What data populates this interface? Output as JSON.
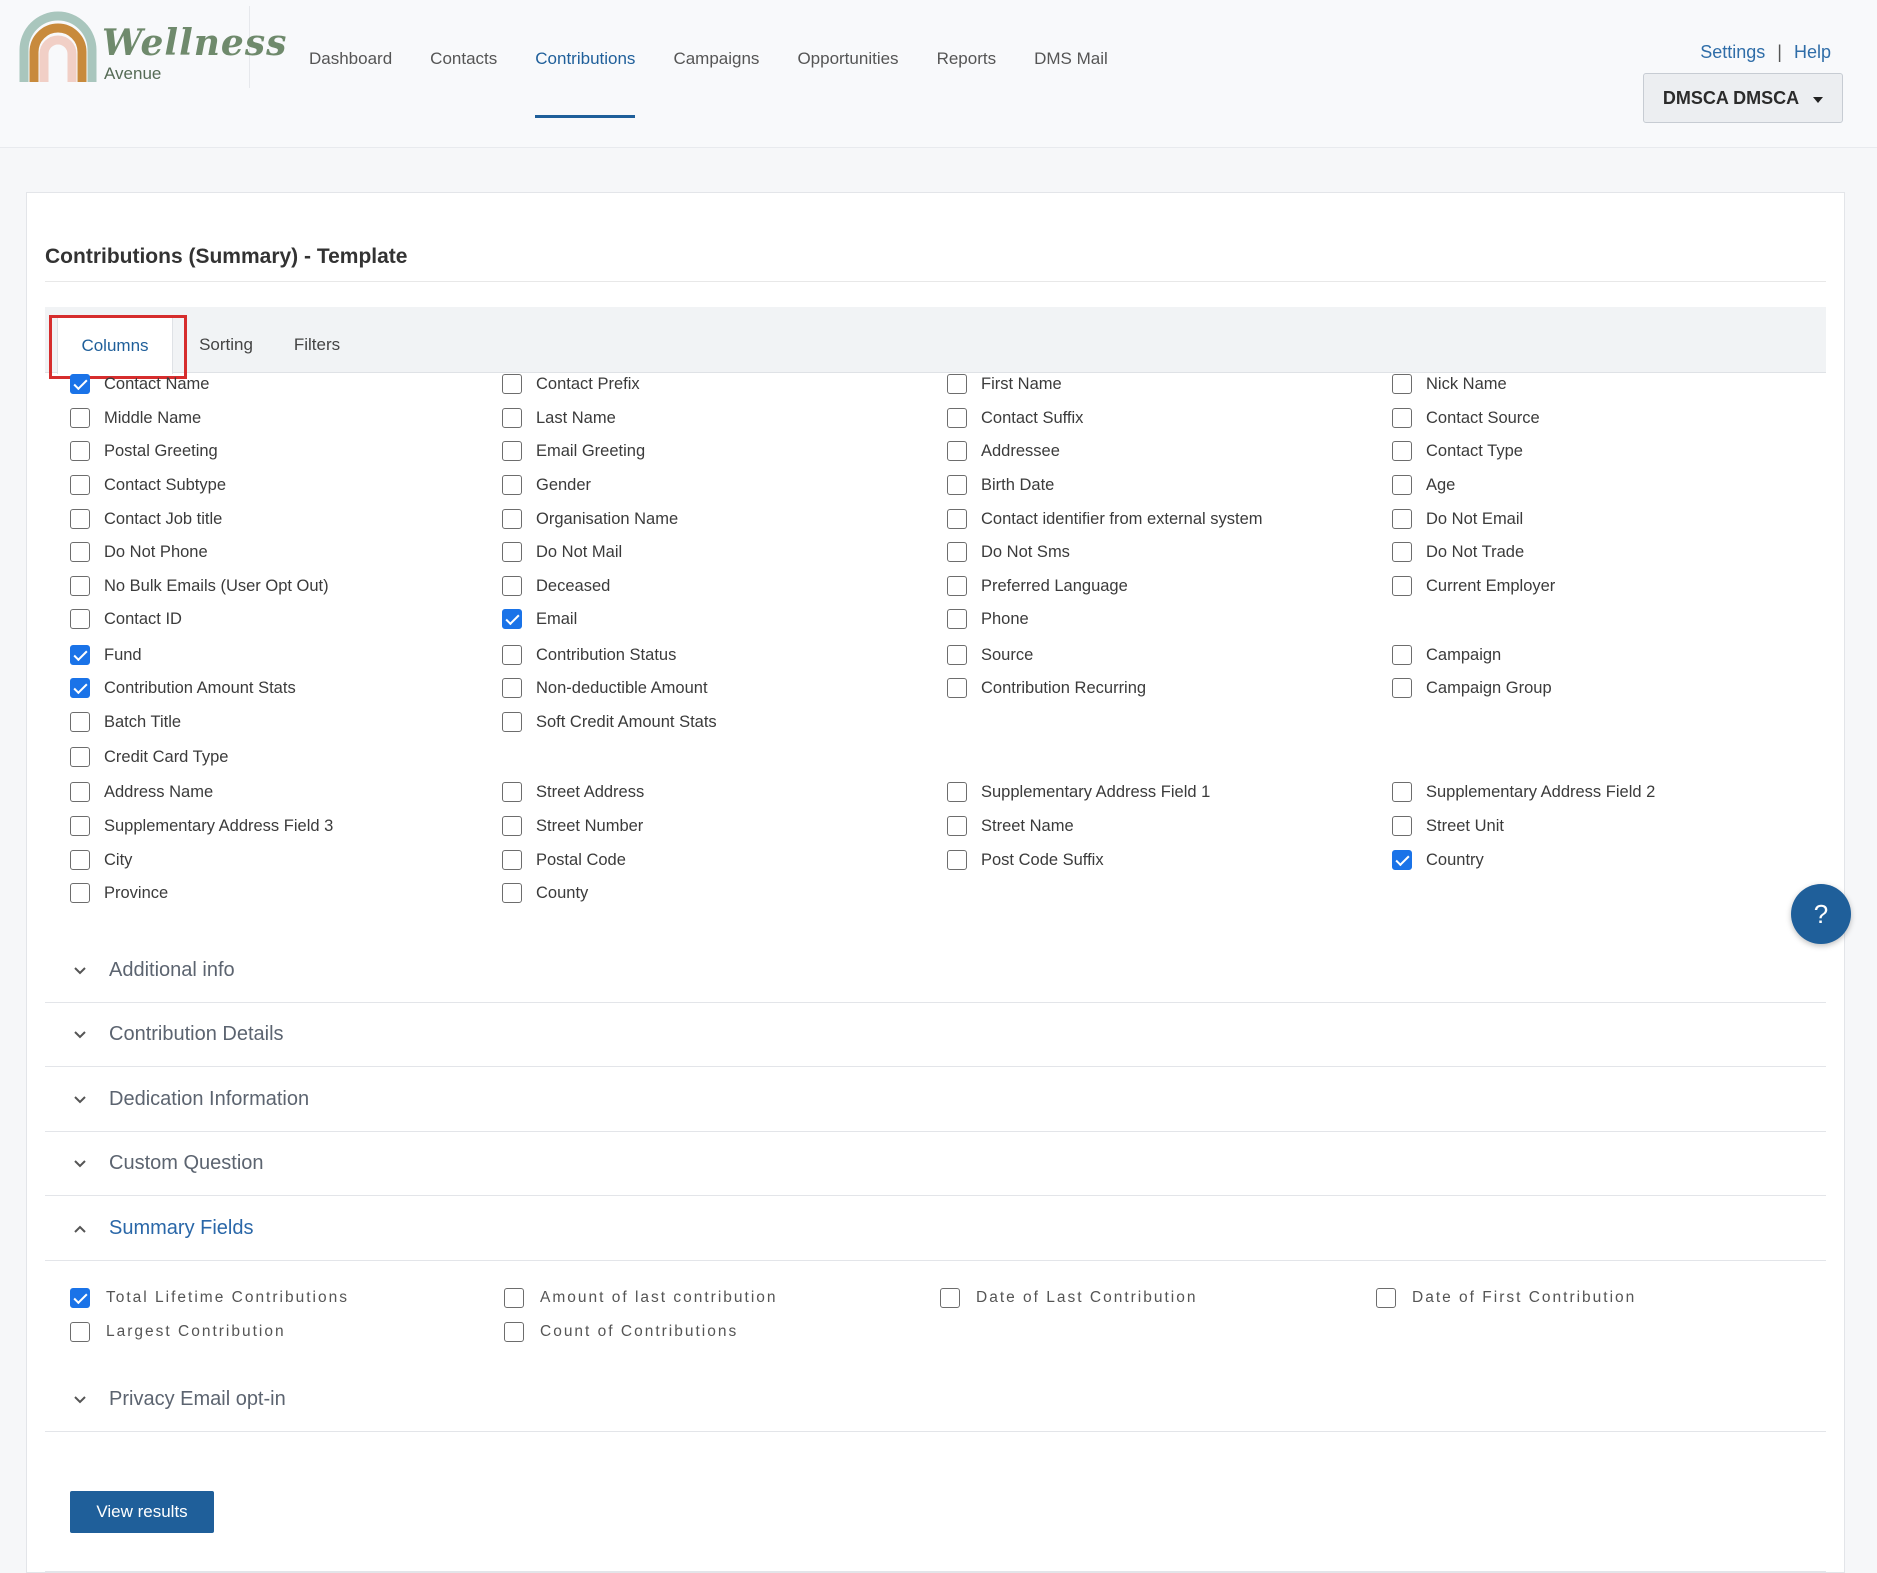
{
  "brand": {
    "name": "Wellness",
    "sub": "Avenue"
  },
  "nav": [
    {
      "label": "Dashboard"
    },
    {
      "label": "Contacts"
    },
    {
      "label": "Contributions",
      "active": true
    },
    {
      "label": "Campaigns"
    },
    {
      "label": "Opportunities"
    },
    {
      "label": "Reports"
    },
    {
      "label": "DMS Mail"
    }
  ],
  "top_links": {
    "settings": "Settings",
    "separator": "|",
    "help": "Help"
  },
  "user_menu": {
    "label": "DMSCA DMSCA"
  },
  "page_title": "Contributions (Summary) - Template",
  "tabs": [
    {
      "label": "Columns",
      "active": true
    },
    {
      "label": "Sorting"
    },
    {
      "label": "Filters"
    }
  ],
  "columns": [
    {
      "label": "Contact Name",
      "checked": true,
      "col": 0,
      "row": 0
    },
    {
      "label": "Contact Prefix",
      "checked": false,
      "col": 1,
      "row": 0
    },
    {
      "label": "First Name",
      "checked": false,
      "col": 2,
      "row": 0
    },
    {
      "label": "Nick Name",
      "checked": false,
      "col": 3,
      "row": 0
    },
    {
      "label": "Middle Name",
      "checked": false,
      "col": 0,
      "row": 1
    },
    {
      "label": "Last Name",
      "checked": false,
      "col": 1,
      "row": 1
    },
    {
      "label": "Contact Suffix",
      "checked": false,
      "col": 2,
      "row": 1
    },
    {
      "label": "Contact Source",
      "checked": false,
      "col": 3,
      "row": 1
    },
    {
      "label": "Postal Greeting",
      "checked": false,
      "col": 0,
      "row": 2
    },
    {
      "label": "Email Greeting",
      "checked": false,
      "col": 1,
      "row": 2
    },
    {
      "label": "Addressee",
      "checked": false,
      "col": 2,
      "row": 2
    },
    {
      "label": "Contact Type",
      "checked": false,
      "col": 3,
      "row": 2
    },
    {
      "label": "Contact Subtype",
      "checked": false,
      "col": 0,
      "row": 3
    },
    {
      "label": "Gender",
      "checked": false,
      "col": 1,
      "row": 3
    },
    {
      "label": "Birth Date",
      "checked": false,
      "col": 2,
      "row": 3
    },
    {
      "label": "Age",
      "checked": false,
      "col": 3,
      "row": 3
    },
    {
      "label": "Contact Job title",
      "checked": false,
      "col": 0,
      "row": 4
    },
    {
      "label": "Organisation Name",
      "checked": false,
      "col": 1,
      "row": 4
    },
    {
      "label": "Contact identifier from external system",
      "checked": false,
      "col": 2,
      "row": 4
    },
    {
      "label": "Do Not Email",
      "checked": false,
      "col": 3,
      "row": 4
    },
    {
      "label": "Do Not Phone",
      "checked": false,
      "col": 0,
      "row": 5
    },
    {
      "label": "Do Not Mail",
      "checked": false,
      "col": 1,
      "row": 5
    },
    {
      "label": "Do Not Sms",
      "checked": false,
      "col": 2,
      "row": 5
    },
    {
      "label": "Do Not Trade",
      "checked": false,
      "col": 3,
      "row": 5
    },
    {
      "label": "No Bulk Emails (User Opt Out)",
      "checked": false,
      "col": 0,
      "row": 6
    },
    {
      "label": "Deceased",
      "checked": false,
      "col": 1,
      "row": 6
    },
    {
      "label": "Preferred Language",
      "checked": false,
      "col": 2,
      "row": 6
    },
    {
      "label": "Current Employer",
      "checked": false,
      "col": 3,
      "row": 6
    },
    {
      "label": "Contact ID",
      "checked": false,
      "col": 0,
      "row": 7
    },
    {
      "label": "Email",
      "checked": true,
      "col": 1,
      "row": 7
    },
    {
      "label": "Phone",
      "checked": false,
      "col": 2,
      "row": 7
    },
    {
      "label": "Fund",
      "checked": true,
      "col": 0,
      "row": 8
    },
    {
      "label": "Contribution Status",
      "checked": false,
      "col": 1,
      "row": 8
    },
    {
      "label": "Source",
      "checked": false,
      "col": 2,
      "row": 8
    },
    {
      "label": "Campaign",
      "checked": false,
      "col": 3,
      "row": 8
    },
    {
      "label": "Contribution Amount Stats",
      "checked": true,
      "col": 0,
      "row": 9
    },
    {
      "label": "Non-deductible Amount",
      "checked": false,
      "col": 1,
      "row": 9
    },
    {
      "label": "Contribution Recurring",
      "checked": false,
      "col": 2,
      "row": 9
    },
    {
      "label": "Campaign Group",
      "checked": false,
      "col": 3,
      "row": 9
    },
    {
      "label": "Batch Title",
      "checked": false,
      "col": 0,
      "row": 10
    },
    {
      "label": "Soft Credit Amount Stats",
      "checked": false,
      "col": 1,
      "row": 10
    },
    {
      "label": "Credit Card Type",
      "checked": false,
      "col": 0,
      "row": 11
    },
    {
      "label": "Address Name",
      "checked": false,
      "col": 0,
      "row": 12
    },
    {
      "label": "Street Address",
      "checked": false,
      "col": 1,
      "row": 12
    },
    {
      "label": "Supplementary Address Field 1",
      "checked": false,
      "col": 2,
      "row": 12
    },
    {
      "label": "Supplementary Address Field 2",
      "checked": false,
      "col": 3,
      "row": 12
    },
    {
      "label": "Supplementary Address Field 3",
      "checked": false,
      "col": 0,
      "row": 13
    },
    {
      "label": "Street Number",
      "checked": false,
      "col": 1,
      "row": 13
    },
    {
      "label": "Street Name",
      "checked": false,
      "col": 2,
      "row": 13
    },
    {
      "label": "Street Unit",
      "checked": false,
      "col": 3,
      "row": 13
    },
    {
      "label": "City",
      "checked": false,
      "col": 0,
      "row": 14
    },
    {
      "label": "Postal Code",
      "checked": false,
      "col": 1,
      "row": 14
    },
    {
      "label": "Post Code Suffix",
      "checked": false,
      "col": 2,
      "row": 14
    },
    {
      "label": "Country",
      "checked": true,
      "col": 3,
      "row": 14
    },
    {
      "label": "Province",
      "checked": false,
      "col": 0,
      "row": 15
    },
    {
      "label": "County",
      "checked": false,
      "col": 1,
      "row": 15
    }
  ],
  "sections": [
    {
      "label": "Additional info",
      "open": false
    },
    {
      "label": "Contribution Details",
      "open": false
    },
    {
      "label": "Dedication Information",
      "open": false
    },
    {
      "label": "Custom Question",
      "open": false
    },
    {
      "label": "Summary Fields",
      "open": true
    },
    {
      "label": "Privacy Email opt-in",
      "open": false
    }
  ],
  "summary_fields": [
    {
      "label": "Total Lifetime Contributions",
      "checked": true,
      "col": 0,
      "row": 0
    },
    {
      "label": "Amount of last contribution",
      "checked": false,
      "col": 1,
      "row": 0
    },
    {
      "label": "Date of Last Contribution",
      "checked": false,
      "col": 2,
      "row": 0
    },
    {
      "label": "Date of First Contribution",
      "checked": false,
      "col": 3,
      "row": 0
    },
    {
      "label": "Largest Contribution",
      "checked": false,
      "col": 0,
      "row": 1
    },
    {
      "label": "Count of Contributions",
      "checked": false,
      "col": 1,
      "row": 1
    }
  ],
  "view_results": "View results",
  "help_fab": "?",
  "colors": {
    "primary": "#1f5f9a",
    "checkbox": "#1a73e8",
    "highlight": "#d62d2d",
    "brand_green": "#6f8a6c"
  },
  "icons": {
    "dropdown": "caret-down-icon",
    "collapse": "chevron-icon",
    "help": "question-icon"
  }
}
